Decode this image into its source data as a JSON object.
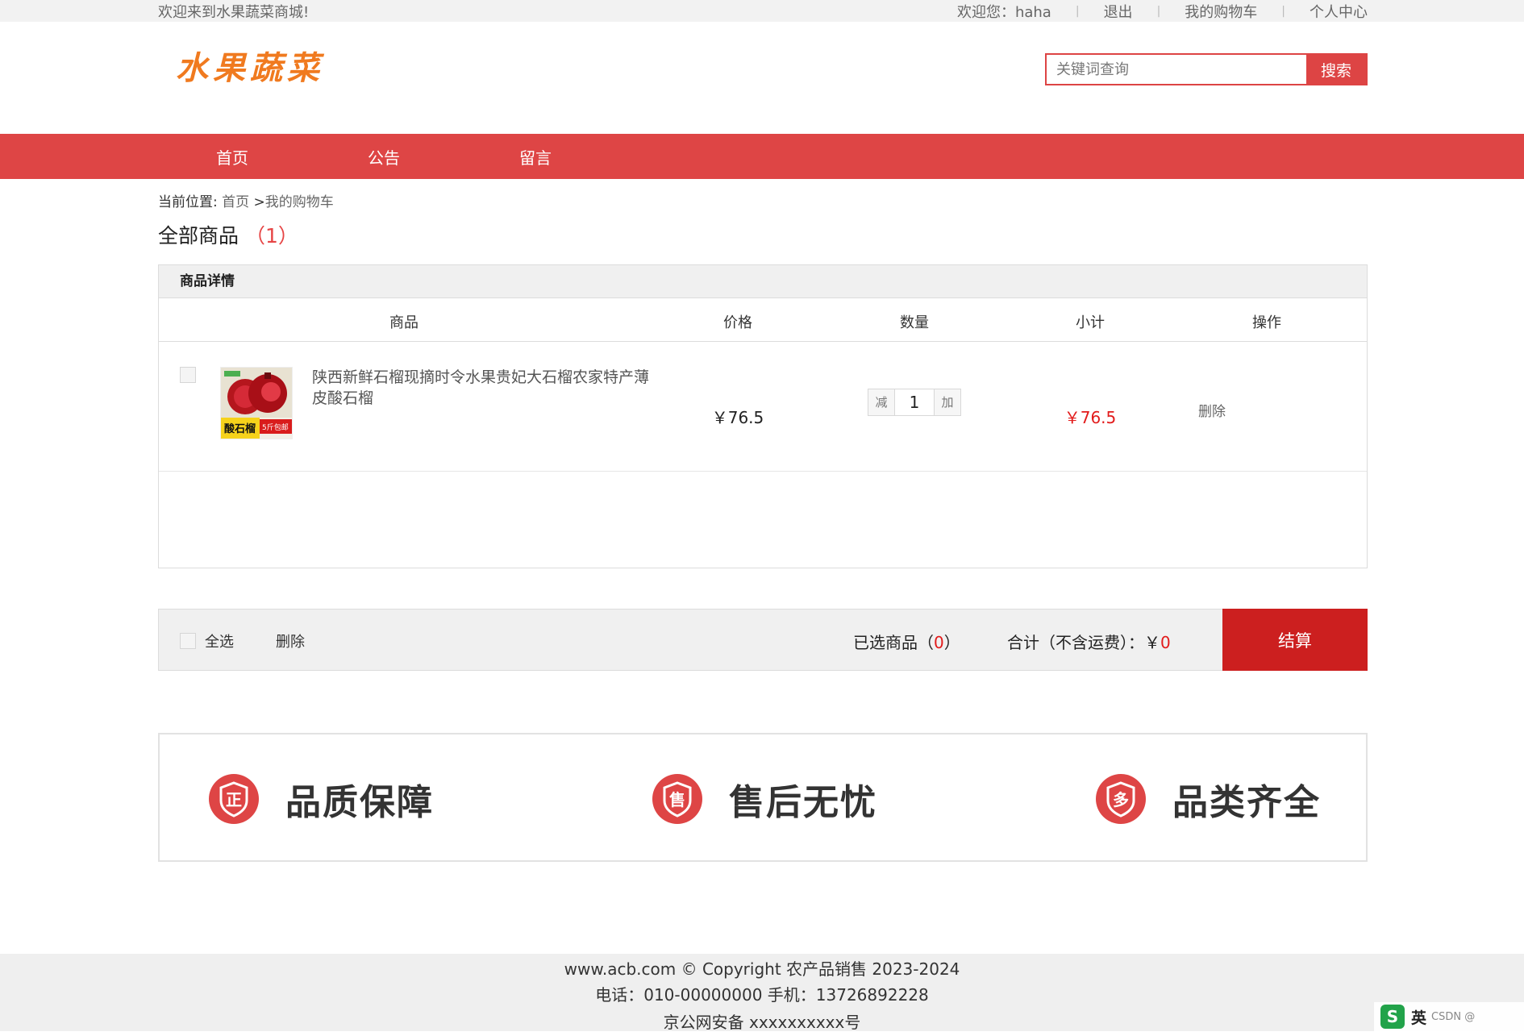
{
  "topbar": {
    "welcome": "欢迎来到水果蔬菜商城!",
    "user_greeting": "欢迎您：haha",
    "logout": "退出",
    "my_cart": "我的购物车",
    "personal_center": "个人中心"
  },
  "header": {
    "logo": "水果蔬菜",
    "search_placeholder": "关键词查询",
    "search_button": "搜索"
  },
  "nav": [
    "首页",
    "公告",
    "留言"
  ],
  "breadcrumb": {
    "label": "当前位置:",
    "home": "首页",
    "sep": ">",
    "current": "我的购物车"
  },
  "cart": {
    "title": "全部商品",
    "count": "（1）",
    "section_header": "商品详情",
    "columns": {
      "product": "商品",
      "price": "价格",
      "quantity": "数量",
      "subtotal": "小计",
      "action": "操作"
    },
    "items": [
      {
        "name": "陕西新鲜石榴现摘时令水果贵妃大石榴农家特产薄皮酸石榴",
        "image_text": "酸石榴",
        "image_badge": "5斤包邮",
        "price": "￥76.5",
        "qty_minus": "减",
        "quantity": "1",
        "qty_plus": "加",
        "subtotal": "￥76.5",
        "delete": "删除"
      }
    ]
  },
  "cart_bar": {
    "select_all": "全选",
    "delete": "删除",
    "selected_label": "已选商品（",
    "selected_count": "0",
    "selected_end": "）",
    "total_label": "合计（不含运费）：￥",
    "total_value": "0",
    "checkout": "结算"
  },
  "guarantees": [
    {
      "icon": "zheng-badge-icon",
      "glyph": "正",
      "label": "品质保障"
    },
    {
      "icon": "shou-badge-icon",
      "glyph": "售",
      "label": "售后无忧"
    },
    {
      "icon": "duo-badge-icon",
      "glyph": "多",
      "label": "品类齐全"
    }
  ],
  "footer": {
    "line1": "www.acb.com © Copyright 农产品销售 2023-2024",
    "line2": "电话：010-00000000 手机：13726892228",
    "line3": "京公网安备 xxxxxxxxxx号"
  },
  "ime": {
    "lang": "英",
    "watermark": "CSDN @"
  },
  "colors": {
    "brand_red": "#de4545",
    "checkout_red": "#cc1f1f",
    "price_red": "#e21b1b",
    "logo_orange": "#f07a1f"
  }
}
